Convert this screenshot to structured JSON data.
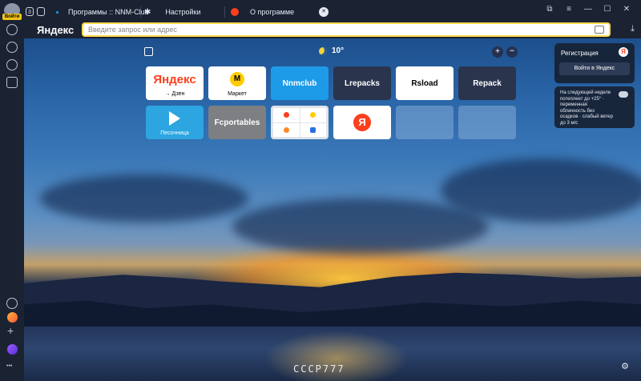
{
  "sidebar": {
    "avatar_badge": "Войти",
    "plus": "+",
    "more": "•••"
  },
  "tabs": [
    {
      "label": "Программы :: NNM-Club"
    },
    {
      "label": "Настройки"
    },
    {
      "label": "О программе"
    }
  ],
  "tab_counter": "3",
  "tab_close": "✕",
  "address": {
    "logo": "Яндекс",
    "placeholder": "Введите запрос или адрес"
  },
  "weather": {
    "temp": "10°"
  },
  "toolbar": {
    "add": "+",
    "more": "•••"
  },
  "tiles": [
    {
      "label": "Яндекс",
      "sub": "→ Дзен"
    },
    {
      "label": "М",
      "sub": "Маркет"
    },
    {
      "label": "Nnmclub"
    },
    {
      "label": "Lrepacks"
    },
    {
      "label": "Rsload"
    },
    {
      "label": "Repack"
    },
    {
      "label": "",
      "sub": "Песочница"
    },
    {
      "label": "Fcportables"
    },
    {
      "label": ""
    },
    {
      "label": "Я"
    },
    {
      "label": ""
    },
    {
      "label": ""
    }
  ],
  "panel": {
    "reg_title": "Регистрация",
    "reg_logo": "Я",
    "login_button": "Войти в Яндекс",
    "forecast": "На следующей неделе потеплеет до +25° · переменная облачность без осадков · слабый ветер до 3 м/с"
  },
  "watermark": "СССР777",
  "window": {
    "minimize": "—",
    "maximize": "☐",
    "close": "✕"
  },
  "colors": {
    "accent_yellow": "#ffdb4d",
    "yandex_red": "#fc3f1d",
    "nnmclub_blue": "#1e9be8",
    "dark_tile": "#2a344d",
    "telegram": "#2ca5e0",
    "fcportables": "#7d7f82"
  }
}
